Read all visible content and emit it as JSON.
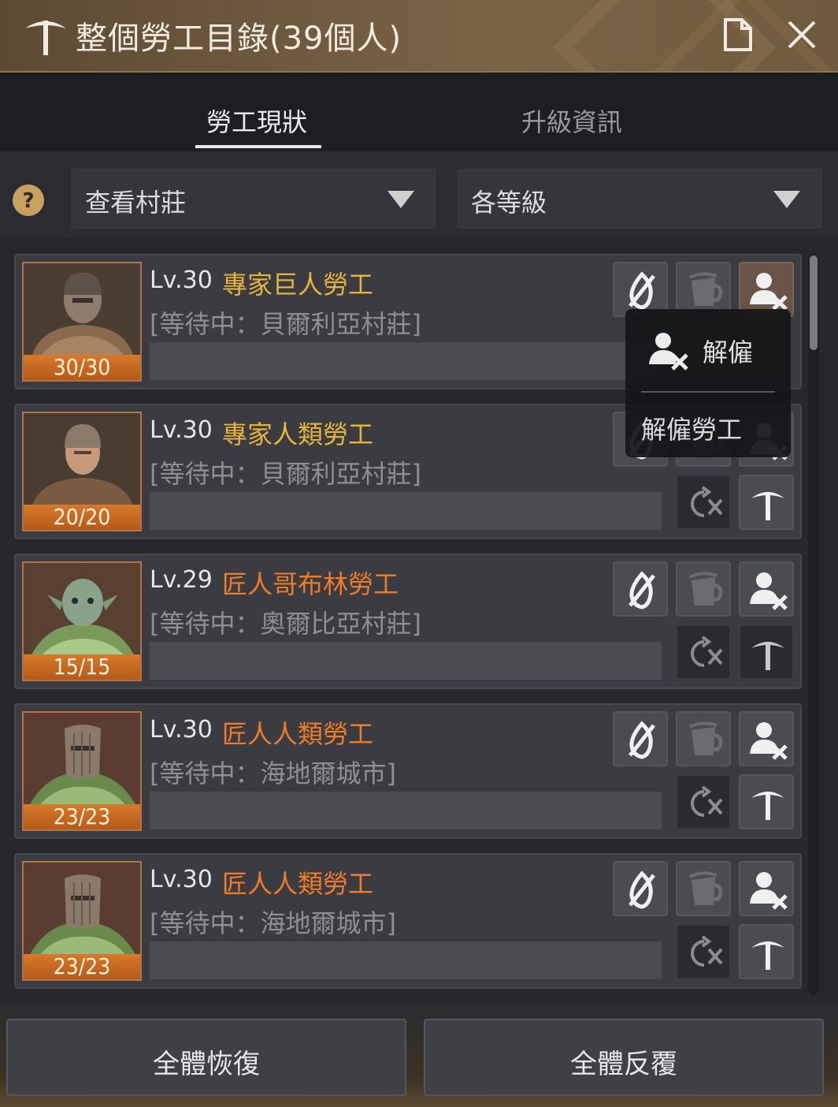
{
  "window": {
    "title": "整個勞工目錄(39個人)"
  },
  "tabs": [
    {
      "label": "勞工現狀",
      "active": true
    },
    {
      "label": "升級資訊",
      "active": false
    }
  ],
  "filters": {
    "village": "查看村莊",
    "level": "各等級"
  },
  "workers": [
    {
      "level": "Lv.30",
      "name": "專家巨人勞工",
      "grade": "gold",
      "status": "[等待中：貝爾利亞村莊]",
      "stamina": "30/30",
      "portrait": "giant-worker-portrait"
    },
    {
      "level": "Lv.30",
      "name": "專家人類勞工",
      "grade": "gold",
      "status": "[等待中：貝爾利亞村莊]",
      "stamina": "20/20",
      "portrait": "human-worker-portrait"
    },
    {
      "level": "Lv.29",
      "name": "匠人哥布林勞工",
      "grade": "orange",
      "status": "[等待中：奧爾比亞村莊]",
      "stamina": "15/15",
      "portrait": "goblin-worker-portrait"
    },
    {
      "level": "Lv.30",
      "name": "匠人人類勞工",
      "grade": "orange",
      "status": "[等待中：海地爾城市]",
      "stamina": "23/23",
      "portrait": "masked-worker-portrait"
    },
    {
      "level": "Lv.30",
      "name": "匠人人類勞工",
      "grade": "orange",
      "status": "[等待中：海地爾城市]",
      "stamina": "23/23",
      "portrait": "masked-worker-portrait"
    }
  ],
  "popup": {
    "dismiss_label": "解僱",
    "dismiss_worker_label": "解僱勞工"
  },
  "bottom": {
    "recover_all": "全體恢復",
    "repeat_all": "全體反覆"
  },
  "colors": {
    "gold_name": "#e6b43c",
    "orange_name": "#ee7c28",
    "badge": "#d77a2a",
    "titlebar": "#6e5a3f"
  }
}
